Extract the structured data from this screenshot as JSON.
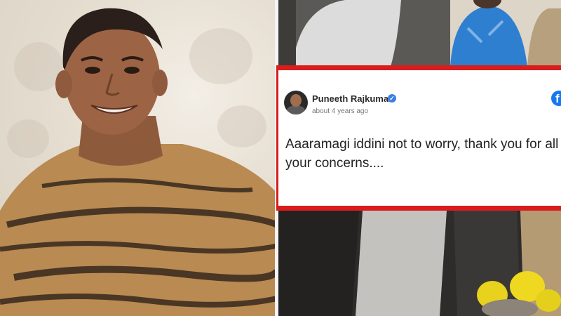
{
  "post": {
    "author": "Puneeth Rajkumar",
    "timestamp": "about 4 years ago",
    "text": "Aaaramagi iddini not to worry, thank you for all your concerns...."
  },
  "icons": {
    "verified": "verified-badge-icon",
    "platform": "facebook-icon"
  },
  "colors": {
    "frame_border": "#d91c1c",
    "verified": "#3c7ee8",
    "facebook": "#1877f2"
  }
}
